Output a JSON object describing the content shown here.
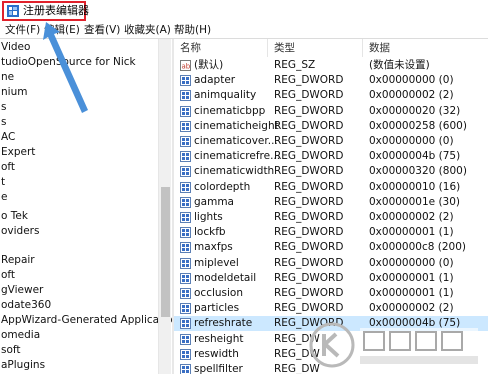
{
  "window": {
    "title": "注册表编辑器"
  },
  "menu": [
    {
      "label": "文件(F)"
    },
    {
      "label": "编辑(E)"
    },
    {
      "label": "查看(V)"
    },
    {
      "label": "收藏夹(A)"
    },
    {
      "label": "帮助(H)"
    }
  ],
  "tree": {
    "items": [
      "Video",
      "tudioOpenSource for Nick",
      "ne",
      "nium",
      "s",
      "s",
      "AC",
      "Expert",
      "oft",
      "t",
      "e",
      "",
      "o Tek",
      "oviders",
      "",
      "Repair",
      "oft",
      "gViewer",
      "odate360",
      "AppWizard-Generated Applicatio",
      "omedia",
      "soft",
      "",
      "aPlugins"
    ]
  },
  "list": {
    "headers": {
      "name": "名称",
      "type": "类型",
      "data": "数据"
    },
    "rows": [
      {
        "name": "(默认)",
        "type": "REG_SZ",
        "data": "(数值未设置)",
        "icon": "string-value-icon"
      },
      {
        "name": "adapter",
        "type": "REG_DWORD",
        "data": "0x00000000 (0)",
        "icon": "binary-value-icon"
      },
      {
        "name": "animquality",
        "type": "REG_DWORD",
        "data": "0x00000002 (2)",
        "icon": "binary-value-icon"
      },
      {
        "name": "cinematicbpp",
        "type": "REG_DWORD",
        "data": "0x00000020 (32)",
        "icon": "binary-value-icon"
      },
      {
        "name": "cinematicheight",
        "type": "REG_DWORD",
        "data": "0x00000258 (600)",
        "icon": "binary-value-icon"
      },
      {
        "name": "cinematicover...",
        "type": "REG_DWORD",
        "data": "0x00000000 (0)",
        "icon": "binary-value-icon"
      },
      {
        "name": "cinematicrefre...",
        "type": "REG_DWORD",
        "data": "0x0000004b (75)",
        "icon": "binary-value-icon"
      },
      {
        "name": "cinematicwidth",
        "type": "REG_DWORD",
        "data": "0x00000320 (800)",
        "icon": "binary-value-icon"
      },
      {
        "name": "colordepth",
        "type": "REG_DWORD",
        "data": "0x00000010 (16)",
        "icon": "binary-value-icon"
      },
      {
        "name": "gamma",
        "type": "REG_DWORD",
        "data": "0x0000001e (30)",
        "icon": "binary-value-icon"
      },
      {
        "name": "lights",
        "type": "REG_DWORD",
        "data": "0x00000002 (2)",
        "icon": "binary-value-icon"
      },
      {
        "name": "lockfb",
        "type": "REG_DWORD",
        "data": "0x00000001 (1)",
        "icon": "binary-value-icon"
      },
      {
        "name": "maxfps",
        "type": "REG_DWORD",
        "data": "0x000000c8 (200)",
        "icon": "binary-value-icon"
      },
      {
        "name": "miplevel",
        "type": "REG_DWORD",
        "data": "0x00000000 (0)",
        "icon": "binary-value-icon"
      },
      {
        "name": "modeldetail",
        "type": "REG_DWORD",
        "data": "0x00000001 (1)",
        "icon": "binary-value-icon"
      },
      {
        "name": "occlusion",
        "type": "REG_DWORD",
        "data": "0x00000001 (1)",
        "icon": "binary-value-icon"
      },
      {
        "name": "particles",
        "type": "REG_DWORD",
        "data": "0x00000002 (2)",
        "icon": "binary-value-icon"
      },
      {
        "name": "refreshrate",
        "type": "REG_DWORD",
        "data": "0x0000004b (75)",
        "icon": "binary-value-icon",
        "selected": true
      },
      {
        "name": "resheight",
        "type": "REG_DW",
        "data": "",
        "icon": "binary-value-icon"
      },
      {
        "name": "reswidth",
        "type": "REG_DW",
        "data": "",
        "icon": "binary-value-icon"
      },
      {
        "name": "spellfilter",
        "type": "REG_DW",
        "data": "",
        "icon": "binary-value-icon"
      }
    ]
  },
  "colors": {
    "highlight_box": "#e0212b",
    "arrow": "#4a90d9",
    "selection": "#cce8ff"
  }
}
